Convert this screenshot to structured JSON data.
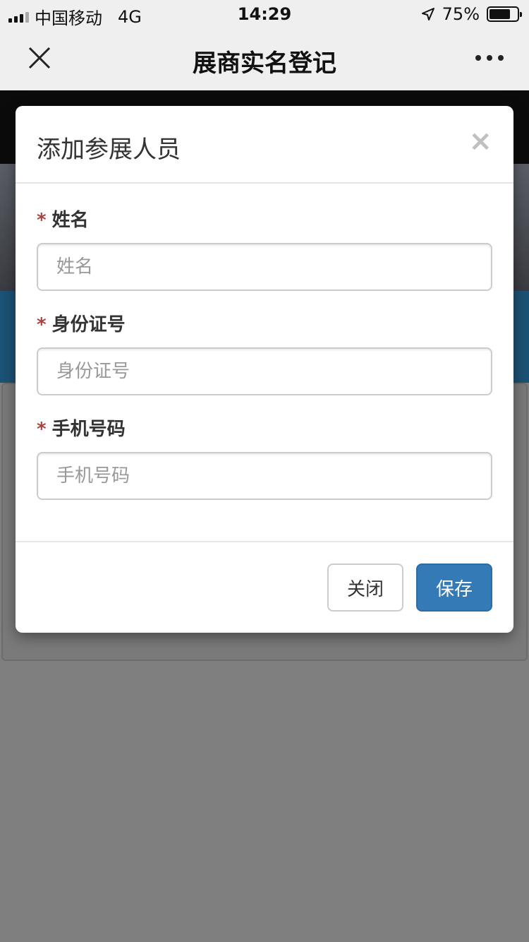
{
  "status_bar": {
    "carrier": "中国移动",
    "network": "4G",
    "time": "14:29",
    "battery_text": "75%",
    "battery_level": 0.75
  },
  "nav": {
    "title": "展商实名登记"
  },
  "modal": {
    "title": "添加参展人员",
    "close_glyph": "×",
    "fields": [
      {
        "required": "*",
        "label": "姓名",
        "placeholder": "姓名"
      },
      {
        "required": "*",
        "label": "身份证号",
        "placeholder": "身份证号"
      },
      {
        "required": "*",
        "label": "手机号码",
        "placeholder": "手机号码"
      }
    ],
    "buttons": {
      "close_label": "关闭",
      "save_label": "保存"
    }
  },
  "colors": {
    "primary": "#337ab7",
    "required": "#a94442",
    "overlay": "#808080"
  }
}
